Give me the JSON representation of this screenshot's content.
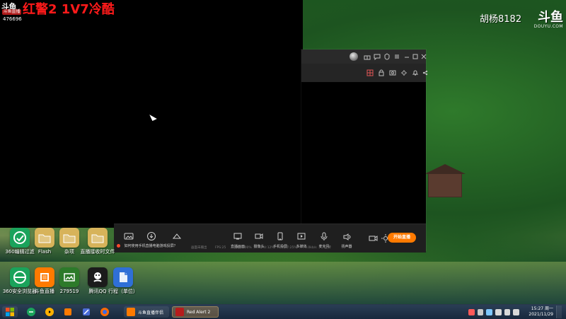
{
  "overlay": {
    "title": "红警2  1V7冷酷",
    "room_pill": "斗鱼直播",
    "room_id": "476696",
    "streamer": "胡杨8182",
    "douyu_logo": "斗鱼",
    "douyu_site": "DOUYU.COM"
  },
  "obs": {
    "bottom_labels": [
      "直播画面",
      "摄像头",
      "手机投屏",
      "多媒体",
      "麦克风",
      "扬声器"
    ],
    "live_button": "开始直播",
    "notice": "如何使用手机直播电脑游戏投屏？",
    "status": [
      "画面未输出",
      "FPS:25",
      "丢帧:0.00%",
      "CPU:12%",
      "内存:25%",
      "0.0kb/s",
      "上传"
    ]
  },
  "desktop_icons": [
    {
      "label": "360编辑过滤",
      "color": "#1aa35b"
    },
    {
      "label": "Flash",
      "color": "#d7b35a"
    },
    {
      "label": "杂项",
      "color": "#d7b35a"
    },
    {
      "label": "直播接收时文件",
      "color": "#d7b35a"
    },
    {
      "label": "360安全浏览器",
      "color": "#1aa35b"
    },
    {
      "label": "斗鱼直播",
      "color": "#ff7a00"
    },
    {
      "label": "279519",
      "color": "#2d7a2a"
    },
    {
      "label": "腾讯QQ",
      "color": "#1b1b1b"
    },
    {
      "label": "行程（单位）",
      "color": "#2f6fd6"
    }
  ],
  "taskbar": {
    "tasks": [
      {
        "label": "斗鱼直播伴侣",
        "color": "#ff7a00"
      },
      {
        "label": "Red Alert 2",
        "color": "#b51c1c"
      }
    ],
    "clock_time": "15:27 周一",
    "clock_date": "2021/11/29"
  },
  "colors": {
    "accent": "#ff7a00",
    "title_red": "#ff1a1a"
  }
}
